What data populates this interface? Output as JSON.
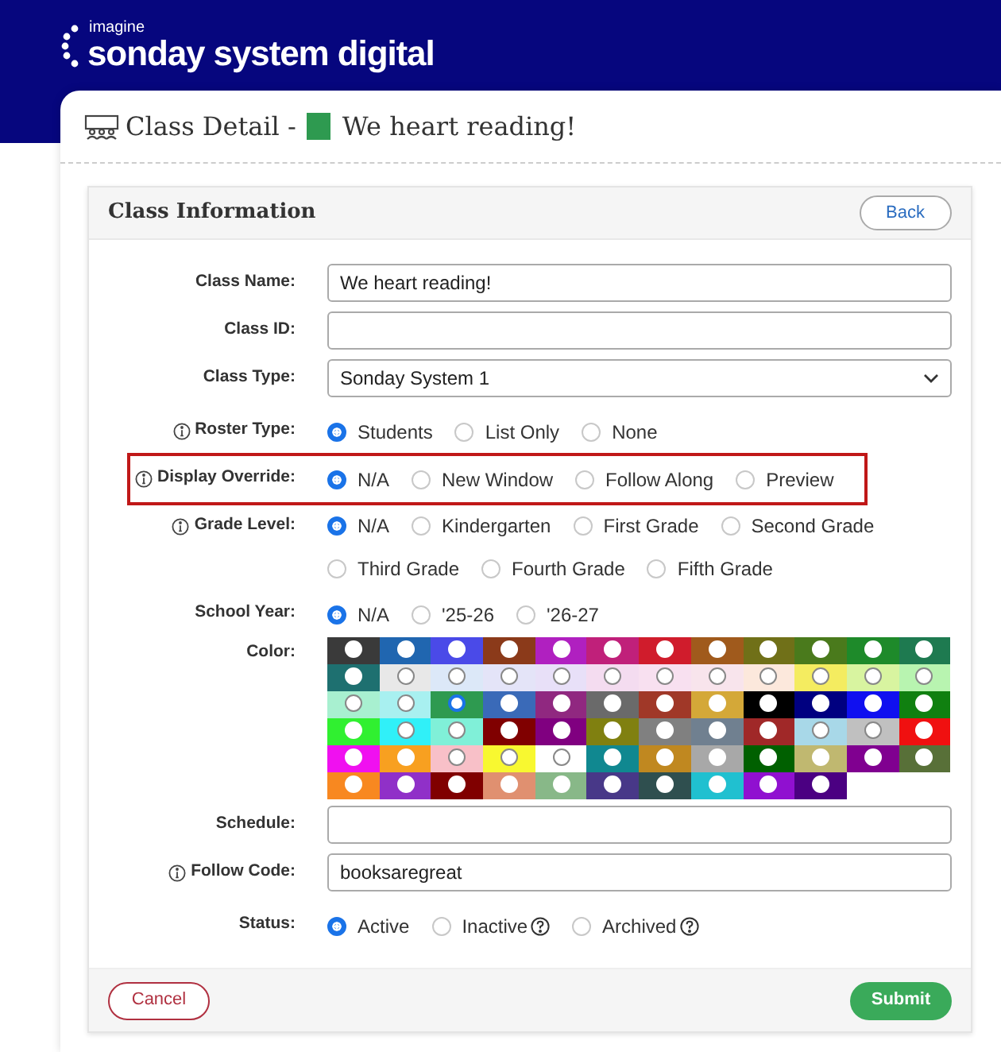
{
  "header": {
    "brand_small": "imagine",
    "brand": "sonday system digital"
  },
  "page": {
    "title": "Class Detail -",
    "class_name": "We heart reading!"
  },
  "section": {
    "title": "Class Information",
    "back": "Back"
  },
  "fields": [
    {
      "kind": "text",
      "label": "Class Name:",
      "info": false,
      "highlighted": false,
      "value": "We heart reading!"
    },
    {
      "kind": "text",
      "label": "Class ID:",
      "info": false,
      "highlighted": false
    },
    {
      "kind": "select",
      "label": "Class Type:",
      "info": false,
      "highlighted": false,
      "value": "Sonday System 1"
    },
    {
      "kind": "radio",
      "label": "Roster Type:",
      "info": true,
      "highlighted": false,
      "options": [
        {
          "label": "Students",
          "selected": true,
          "help": false
        },
        {
          "label": "List Only",
          "selected": false,
          "help": false
        },
        {
          "label": "None",
          "selected": false,
          "help": false
        }
      ]
    },
    {
      "kind": "radio",
      "label": "Display Override:",
      "info": true,
      "highlighted": true,
      "options": [
        {
          "label": "N/A",
          "selected": true,
          "help": false
        },
        {
          "label": "New Window",
          "selected": false,
          "help": false
        },
        {
          "label": "Follow Along",
          "selected": false,
          "help": false
        },
        {
          "label": "Preview",
          "selected": false,
          "help": false
        }
      ]
    },
    {
      "kind": "radio",
      "label": "Grade Level:",
      "info": true,
      "highlighted": false,
      "options": [
        {
          "label": "N/A",
          "selected": true,
          "help": false
        },
        {
          "label": "Kindergarten",
          "selected": false,
          "help": false
        },
        {
          "label": "First Grade",
          "selected": false,
          "help": false
        },
        {
          "label": "Second Grade",
          "selected": false,
          "help": false
        },
        {
          "label": "Third Grade",
          "selected": false,
          "help": false
        },
        {
          "label": "Fourth Grade",
          "selected": false,
          "help": false
        },
        {
          "label": "Fifth Grade",
          "selected": false,
          "help": false
        }
      ]
    },
    {
      "kind": "radio",
      "label": "School Year:",
      "info": false,
      "highlighted": false,
      "options": [
        {
          "label": "N/A",
          "selected": true,
          "help": false
        },
        {
          "label": "'25-26",
          "selected": false,
          "help": false
        },
        {
          "label": "'26-27",
          "selected": false,
          "help": false
        }
      ]
    },
    {
      "kind": "colors",
      "label": "Color:",
      "info": false,
      "highlighted": false,
      "swatches": [
        {
          "color": "#3a3a3a",
          "selected": false
        },
        {
          "color": "#2066b0",
          "selected": false
        },
        {
          "color": "#4a4ae8",
          "selected": false
        },
        {
          "color": "#8b3a1a",
          "selected": false
        },
        {
          "color": "#b020c0",
          "selected": false
        },
        {
          "color": "#c0207a",
          "selected": false
        },
        {
          "color": "#d01c2c",
          "selected": false
        },
        {
          "color": "#a05a1c",
          "selected": false
        },
        {
          "color": "#707018",
          "selected": false
        },
        {
          "color": "#4a7a1c",
          "selected": false
        },
        {
          "color": "#1e8a2a",
          "selected": false
        },
        {
          "color": "#1e7a50",
          "selected": false
        },
        {
          "color": "#1e7070",
          "selected": false
        },
        {
          "color": "#e8e8e8",
          "selected": false
        },
        {
          "color": "#dce8f8",
          "selected": false
        },
        {
          "color": "#e4e4f8",
          "selected": false
        },
        {
          "color": "#e8e0f8",
          "selected": false
        },
        {
          "color": "#f4dcf0",
          "selected": false
        },
        {
          "color": "#f8e0f0",
          "selected": false
        },
        {
          "color": "#f8e4ec",
          "selected": false
        },
        {
          "color": "#fce8dc",
          "selected": false
        },
        {
          "color": "#f4ec60",
          "selected": false
        },
        {
          "color": "#d8f4a0",
          "selected": false
        },
        {
          "color": "#b8f4b0",
          "selected": false
        },
        {
          "color": "#a8f0d0",
          "selected": false
        },
        {
          "color": "#a8f0f0",
          "selected": false
        },
        {
          "color": "#2e9a50",
          "selected": true
        },
        {
          "color": "#3a6ab8",
          "selected": false
        },
        {
          "color": "#902880",
          "selected": false
        },
        {
          "color": "#6a6a6a",
          "selected": false
        },
        {
          "color": "#a03828",
          "selected": false
        },
        {
          "color": "#d4a838",
          "selected": false
        },
        {
          "color": "#000000",
          "selected": false
        },
        {
          "color": "#000080",
          "selected": false
        },
        {
          "color": "#1010f0",
          "selected": false
        },
        {
          "color": "#108010",
          "selected": false
        },
        {
          "color": "#30f030",
          "selected": false
        },
        {
          "color": "#30f0f8",
          "selected": false
        },
        {
          "color": "#80f0d8",
          "selected": false
        },
        {
          "color": "#800000",
          "selected": false
        },
        {
          "color": "#800080",
          "selected": false
        },
        {
          "color": "#808010",
          "selected": false
        },
        {
          "color": "#808080",
          "selected": false
        },
        {
          "color": "#708090",
          "selected": false
        },
        {
          "color": "#a02828",
          "selected": false
        },
        {
          "color": "#a8d8e8",
          "selected": false
        },
        {
          "color": "#c0c0c0",
          "selected": false
        },
        {
          "color": "#f01010",
          "selected": false
        },
        {
          "color": "#f010f0",
          "selected": false
        },
        {
          "color": "#f8a020",
          "selected": false
        },
        {
          "color": "#f8c0c8",
          "selected": false
        },
        {
          "color": "#f8f830",
          "selected": false
        },
        {
          "color": "#ffffff",
          "selected": false
        },
        {
          "color": "#108890",
          "selected": false
        },
        {
          "color": "#c08820",
          "selected": false
        },
        {
          "color": "#a8a8a8",
          "selected": false
        },
        {
          "color": "#006000",
          "selected": false
        },
        {
          "color": "#c0b870",
          "selected": false
        },
        {
          "color": "#800090",
          "selected": false
        },
        {
          "color": "#587038",
          "selected": false
        },
        {
          "color": "#f88820",
          "selected": false
        },
        {
          "color": "#9030c8",
          "selected": false
        },
        {
          "color": "#800000",
          "selected": false
        },
        {
          "color": "#e09070",
          "selected": false
        },
        {
          "color": "#88b888",
          "selected": false
        },
        {
          "color": "#483888",
          "selected": false
        },
        {
          "color": "#2f4f4f",
          "selected": false
        },
        {
          "color": "#20c0d0",
          "selected": false
        },
        {
          "color": "#9010d0",
          "selected": false
        },
        {
          "color": "#4b0082",
          "selected": false
        }
      ]
    },
    {
      "kind": "text",
      "label": "Schedule:",
      "info": false,
      "highlighted": false
    },
    {
      "kind": "text",
      "label": "Follow Code:",
      "info": true,
      "highlighted": false,
      "value": "booksaregreat"
    },
    {
      "kind": "radio",
      "label": "Status:",
      "info": false,
      "highlighted": false,
      "options": [
        {
          "label": "Active",
          "selected": true,
          "help": false
        },
        {
          "label": "Inactive",
          "selected": false,
          "help": true
        },
        {
          "label": "Archived",
          "selected": false,
          "help": true
        }
      ]
    }
  ],
  "footer": {
    "cancel": "Cancel",
    "submit": "Submit"
  }
}
